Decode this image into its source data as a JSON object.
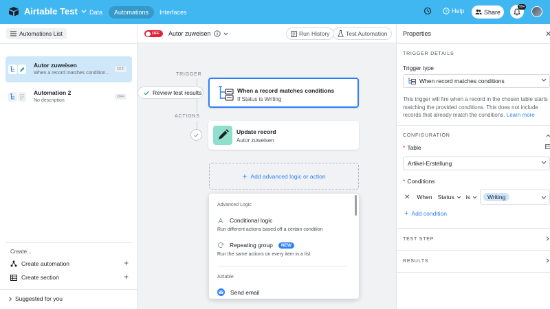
{
  "topbar": {
    "app_title": "Airtable Test",
    "tabs": [
      "Data",
      "Automations",
      "Interfaces"
    ],
    "help": "Help",
    "share": "Share",
    "notification_badge": "99+"
  },
  "left": {
    "list_button": "Automations List",
    "automations": [
      {
        "name": "Autor zuweisen",
        "desc": "When a record matches condition...",
        "status": "OFF"
      },
      {
        "name": "Automation 2",
        "desc": "No description",
        "status": "OFF"
      }
    ],
    "create_label": "Create...",
    "create_automation": "Create automation",
    "create_section": "Create section",
    "suggested": "Suggested for you"
  },
  "center": {
    "toggle_label": "OFF",
    "automation_name": "Autor zuweisen",
    "run_history": "Run History",
    "test_automation": "Test Automation",
    "trigger_label": "TRIGGER",
    "actions_label": "ACTIONS",
    "review_test": "Review test results",
    "trigger_card": {
      "title": "When a record matches conditions",
      "sub": "If Status is Writing"
    },
    "action_card": {
      "title": "Update record",
      "sub": "Autor zuweisen"
    },
    "add_logic": "Add advanced logic or action",
    "dropdown": {
      "section_advanced": "Advanced Logic",
      "conditional": {
        "title": "Conditional logic",
        "desc": "Run different actions based off a certain condition"
      },
      "repeating": {
        "title": "Repeating group",
        "badge": "NEW",
        "desc": "Run the same actions on every item in a list"
      },
      "section_airtable": "Airtable",
      "send_email": "Send email"
    }
  },
  "right": {
    "title": "Properties",
    "trigger_details": "TRIGGER DETAILS",
    "trigger_type_label": "Trigger type",
    "trigger_type_value": "When record matches conditions",
    "trigger_desc": "This trigger will fire when a record in the chosen table starts matching the provided conditions. This does not include records that already match the conditions.",
    "learn_more": "Learn more",
    "configuration": "CONFIGURATION",
    "table_label": "Table",
    "table_value": "Artikel-Erstellung",
    "conditions_label": "Conditions",
    "cond_when": "When",
    "cond_field": "Status",
    "cond_op": "is",
    "cond_value": "Writing",
    "add_condition": "Add condition",
    "test_step": "TEST STEP",
    "results": "RESULTS"
  },
  "colors": {
    "topbar": "#40b7f1",
    "accent": "#2d7ff9",
    "off": "#e0243a"
  }
}
